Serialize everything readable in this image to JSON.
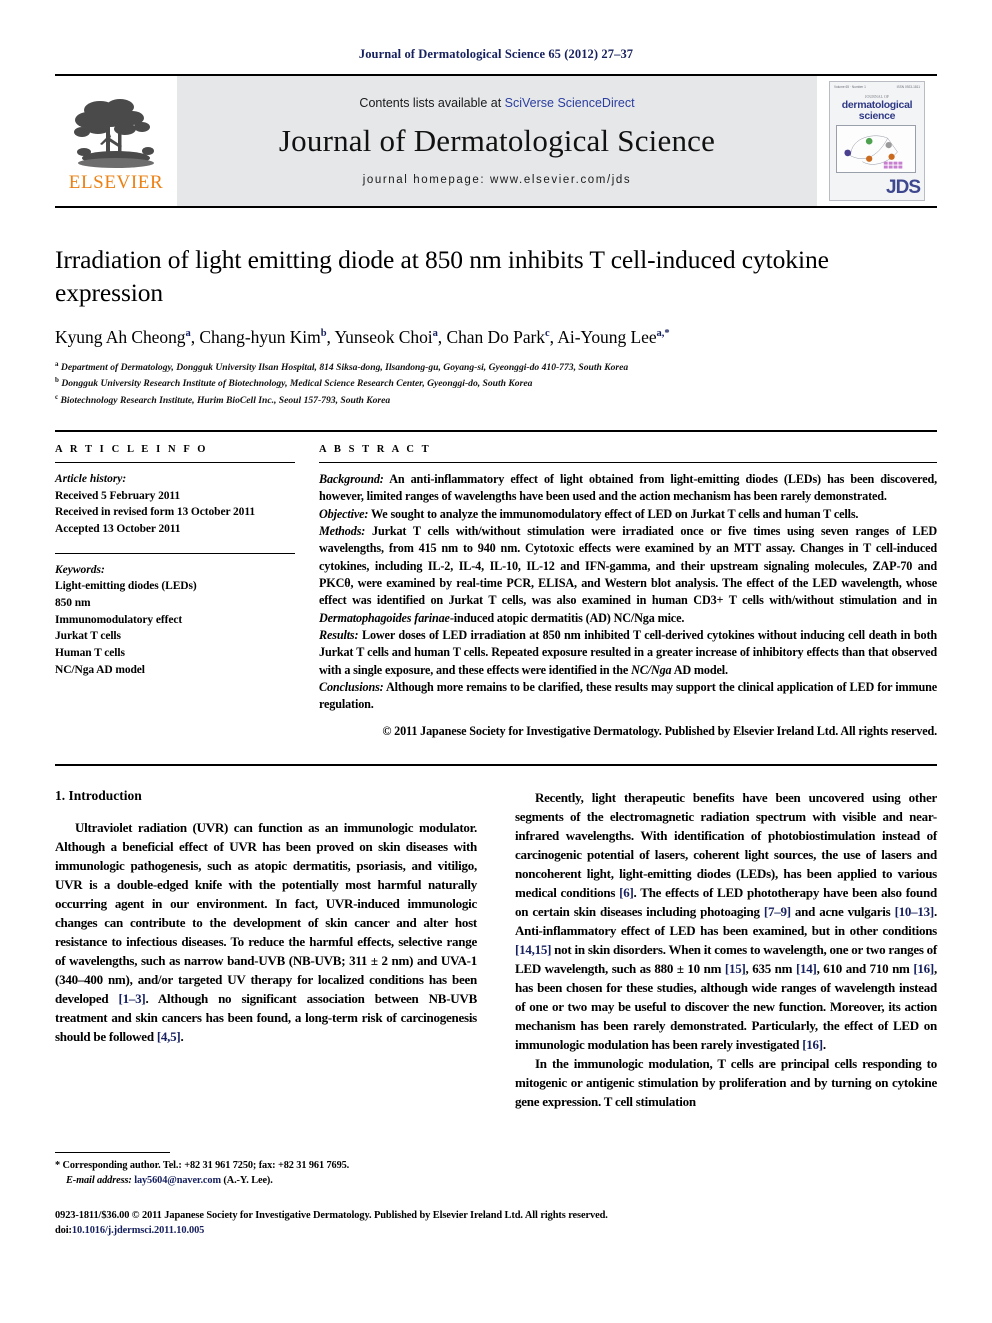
{
  "running_head": "Journal of Dermatological Science 65 (2012) 27–37",
  "masthead": {
    "publisher_logo_label": "ELSEVIER",
    "contents_prefix": "Contents lists available at ",
    "contents_link": "SciVerse ScienceDirect",
    "journal_title": "Journal of Dermatological Science",
    "homepage": "journal homepage: www.elsevier.com/jds",
    "cover": {
      "top_left": "Volume 65 · Number 1",
      "top_right": "ISSN 0923-1811",
      "small_title": "JOURNAL OF",
      "name_line1": "dermatological",
      "name_line2": "science",
      "badge": "JDS"
    }
  },
  "article": {
    "title": "Irradiation of light emitting diode at 850 nm inhibits T cell-induced cytokine expression",
    "authors": [
      {
        "name": "Kyung Ah Cheong",
        "marks": "a"
      },
      {
        "name": "Chang-hyun Kim",
        "marks": "b"
      },
      {
        "name": "Yunseok Choi",
        "marks": "a"
      },
      {
        "name": "Chan Do Park",
        "marks": "c"
      },
      {
        "name": "Ai-Young Lee",
        "marks": "a,*"
      }
    ],
    "affiliations": [
      {
        "mark": "a",
        "text": "Department of Dermatology, Dongguk University Ilsan Hospital, 814 Siksa-dong, Ilsandong-gu, Goyang-si, Gyeonggi-do 410-773, South Korea"
      },
      {
        "mark": "b",
        "text": "Dongguk University Research Institute of Biotechnology, Medical Science Research Center, Gyeonggi-do, South Korea"
      },
      {
        "mark": "c",
        "text": "Biotechnology Research Institute, Hurim BioCell Inc., Seoul 157-793, South Korea"
      }
    ]
  },
  "article_info": {
    "heading": "A R T I C L E  I N F O",
    "history_label": "Article history:",
    "history": [
      "Received 5 February 2011",
      "Received in revised form 13 October 2011",
      "Accepted 13 October 2011"
    ],
    "keywords_label": "Keywords:",
    "keywords": [
      "Light-emitting diodes (LEDs)",
      "850 nm",
      "Immunomodulatory effect",
      "Jurkat T cells",
      "Human T cells",
      "NC/Nga AD model"
    ]
  },
  "abstract": {
    "heading": "A B S T R A C T",
    "sections": [
      {
        "label": "Background:",
        "text": "An anti-inflammatory effect of light obtained from light-emitting diodes (LEDs) has been discovered, however, limited ranges of wavelengths have been used and the action mechanism has been rarely demonstrated."
      },
      {
        "label": "Objective:",
        "text": "We sought to analyze the immunomodulatory effect of LED on Jurkat T cells and human T cells."
      },
      {
        "label": "Methods:",
        "text": "Jurkat T cells with/without stimulation were irradiated once or five times using seven ranges of LED wavelengths, from 415 nm to 940 nm. Cytotoxic effects were examined by an MTT assay. Changes in T cell-induced cytokines, including IL-2, IL-4, IL-10, IL-12 and IFN-gamma, and their upstream signaling molecules, ZAP-70 and PKCθ, were examined by real-time PCR, ELISA, and Western blot analysis. The effect of the LED wavelength, whose effect was identified on Jurkat T cells, was also examined in human CD3+ T cells with/without stimulation and in Dermatophagoides farinae-induced atopic dermatitis (AD) NC/Nga mice.",
        "italic_phrase": "Dermatophagoides farinae"
      },
      {
        "label": "Results:",
        "text": "Lower doses of LED irradiation at 850 nm inhibited T cell-derived cytokines without inducing cell death in both Jurkat T cells and human T cells. Repeated exposure resulted in a greater increase of inhibitory effects than that observed with a single exposure, and these effects were identified in the NC/Nga AD model.",
        "italic_phrase": "NC/Nga"
      },
      {
        "label": "Conclusions:",
        "text": "Although more remains to be clarified, these results may support the clinical application of LED for immune regulation."
      }
    ],
    "copyright": "© 2011 Japanese Society for Investigative Dermatology. Published by Elsevier Ireland Ltd. All rights reserved."
  },
  "body": {
    "section_number_title": "1. Introduction",
    "left_paragraphs": [
      "Ultraviolet radiation (UVR) can function as an immunologic modulator. Although a beneficial effect of UVR has been proved on skin diseases with immunologic pathogenesis, such as atopic dermatitis, psoriasis, and vitiligo, UVR is a double-edged knife with the potentially most harmful naturally occurring agent in our environment. In fact, UVR-induced immunologic changes can contribute to the development of skin cancer and alter host resistance to infectious diseases. To reduce the harmful effects, selective range of wavelengths, such as narrow band-UVB (NB-UVB; 311 ± 2 nm) and UVA-1 (340–400 nm), and/or targeted UV therapy for localized conditions has been developed [1–3]. Although no significant association between NB-UVB treatment and skin cancers has been found, a long-term risk of carcinogenesis should be followed [4,5]."
    ],
    "right_paragraphs": [
      "Recently, light therapeutic benefits have been uncovered using other segments of the electromagnetic radiation spectrum with visible and near-infrared wavelengths. With identification of photobiostimulation instead of carcinogenic potential of lasers, coherent light sources, the use of lasers and noncoherent light, light-emitting diodes (LEDs), has been applied to various medical conditions [6]. The effects of LED phototherapy have been also found on certain skin diseases including photoaging [7–9] and acne vulgaris [10–13]. Anti-inflammatory effect of LED has been examined, but in other conditions [14,15] not in skin disorders. When it comes to wavelength, one or two ranges of LED wavelength, such as 880 ± 10 nm [15], 635 nm [14], 610 and 710 nm [16], has been chosen for these studies, although wide ranges of wavelength instead of one or two may be useful to discover the new function. Moreover, its action mechanism has been rarely demonstrated. Particularly, the effect of LED on immunologic modulation has been rarely investigated [16].",
      "In the immunologic modulation, T cells are principal cells responding to mitogenic or antigenic stimulation by proliferation and by turning on cytokine gene expression. T cell stimulation"
    ]
  },
  "footnote": {
    "marker": "*",
    "corresponding": "Corresponding author. Tel.: +82 31 961 7250; fax: +82 31 961 7695.",
    "email_label": "E-mail address:",
    "email": "lay5604@naver.com",
    "email_suffix": "(A.-Y. Lee)."
  },
  "page_footer": {
    "issn_line": "0923-1811/$36.00 © 2011 Japanese Society for Investigative Dermatology. Published by Elsevier Ireland Ltd. All rights reserved.",
    "doi_label": "doi:",
    "doi": "10.1016/j.jdermsci.2011.10.005"
  },
  "colors": {
    "running_head": "#16205e",
    "link": "#2b3ea0",
    "reference": "#16205e",
    "elsevier_orange": "#ec8013",
    "masthead_bg": "#e6e7e9"
  }
}
